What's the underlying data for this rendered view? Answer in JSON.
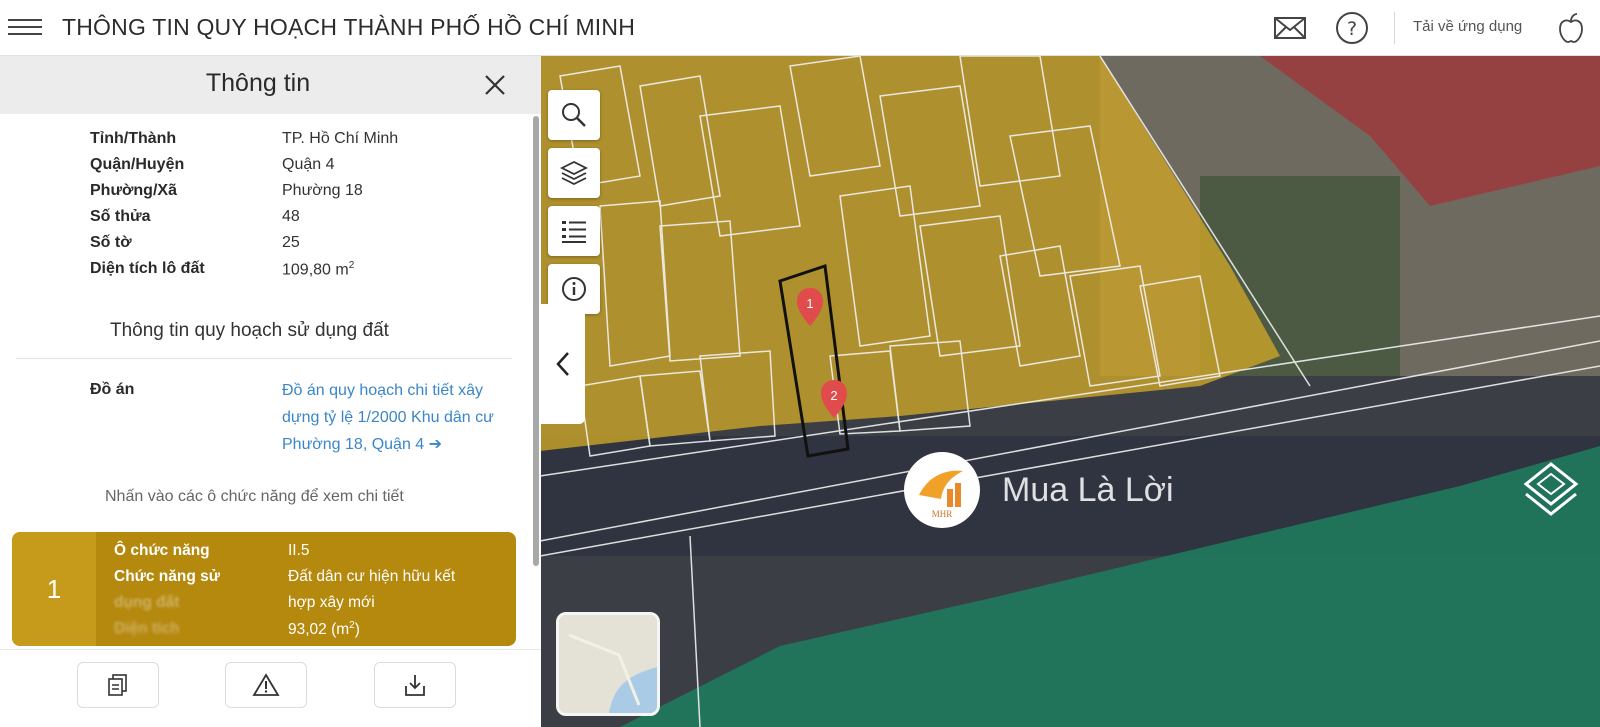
{
  "header": {
    "title": "THÔNG TIN QUY HOẠCH THÀNH PHỐ HỒ CHÍ MINH",
    "download_app_label": "Tải về ứng dụng"
  },
  "panel": {
    "title": "Thông tin",
    "info_rows": [
      {
        "label": "Tỉnh/Thành",
        "value": "TP. Hồ Chí Minh"
      },
      {
        "label": "Quận/Huyện",
        "value": "Quận 4"
      },
      {
        "label": "Phường/Xã",
        "value": "Phường 18"
      },
      {
        "label": "Số thửa",
        "value": "48"
      },
      {
        "label": "Số tờ",
        "value": "25"
      },
      {
        "label": "Diện tích lô đất",
        "value": "109,80 m",
        "unit_sup": "2"
      }
    ],
    "section_title": "Thông tin quy hoạch sử dụng đất",
    "do_an_label": "Đồ án",
    "do_an_link": "Đồ án quy hoạch chi tiết xây dựng tỷ lệ 1/2000 Khu dân cư Phường 18, Quận 4",
    "do_an_arrow": "➔",
    "hint": "Nhấn vào các ô chức năng để xem chi tiết",
    "function_card": {
      "number": "1",
      "o_chuc_nang_label": "Ô chức năng",
      "o_chuc_nang_value": "II.5",
      "chuc_nang_label": "Chức năng sử",
      "chuc_nang_label_2": "dụng đất",
      "chuc_nang_value": "Đất dân cư hiện hữu kết",
      "chuc_nang_value_2": "hợp xây mới",
      "dien_tich_label": "Diện tích",
      "dien_tich_value": "93,02 (m",
      "dien_tich_sup": "2",
      "dien_tich_close": ")",
      "color": "#b5880e"
    }
  },
  "map": {
    "markers": [
      "1",
      "2"
    ],
    "watermark_text": "Mua Là Lời",
    "watermark_logo_text": "MHR",
    "zone_colors": {
      "residential": "#c9a22a",
      "public": "#b0494b",
      "green": "#1f7a5c"
    }
  },
  "icons": {
    "header": [
      "menu-icon",
      "mail-icon",
      "help-icon",
      "apple-icon"
    ],
    "map_tools": [
      "search-icon",
      "layers-icon",
      "list-icon",
      "info-icon"
    ],
    "bottom": [
      "document-icon",
      "warning-icon",
      "download-icon"
    ]
  }
}
